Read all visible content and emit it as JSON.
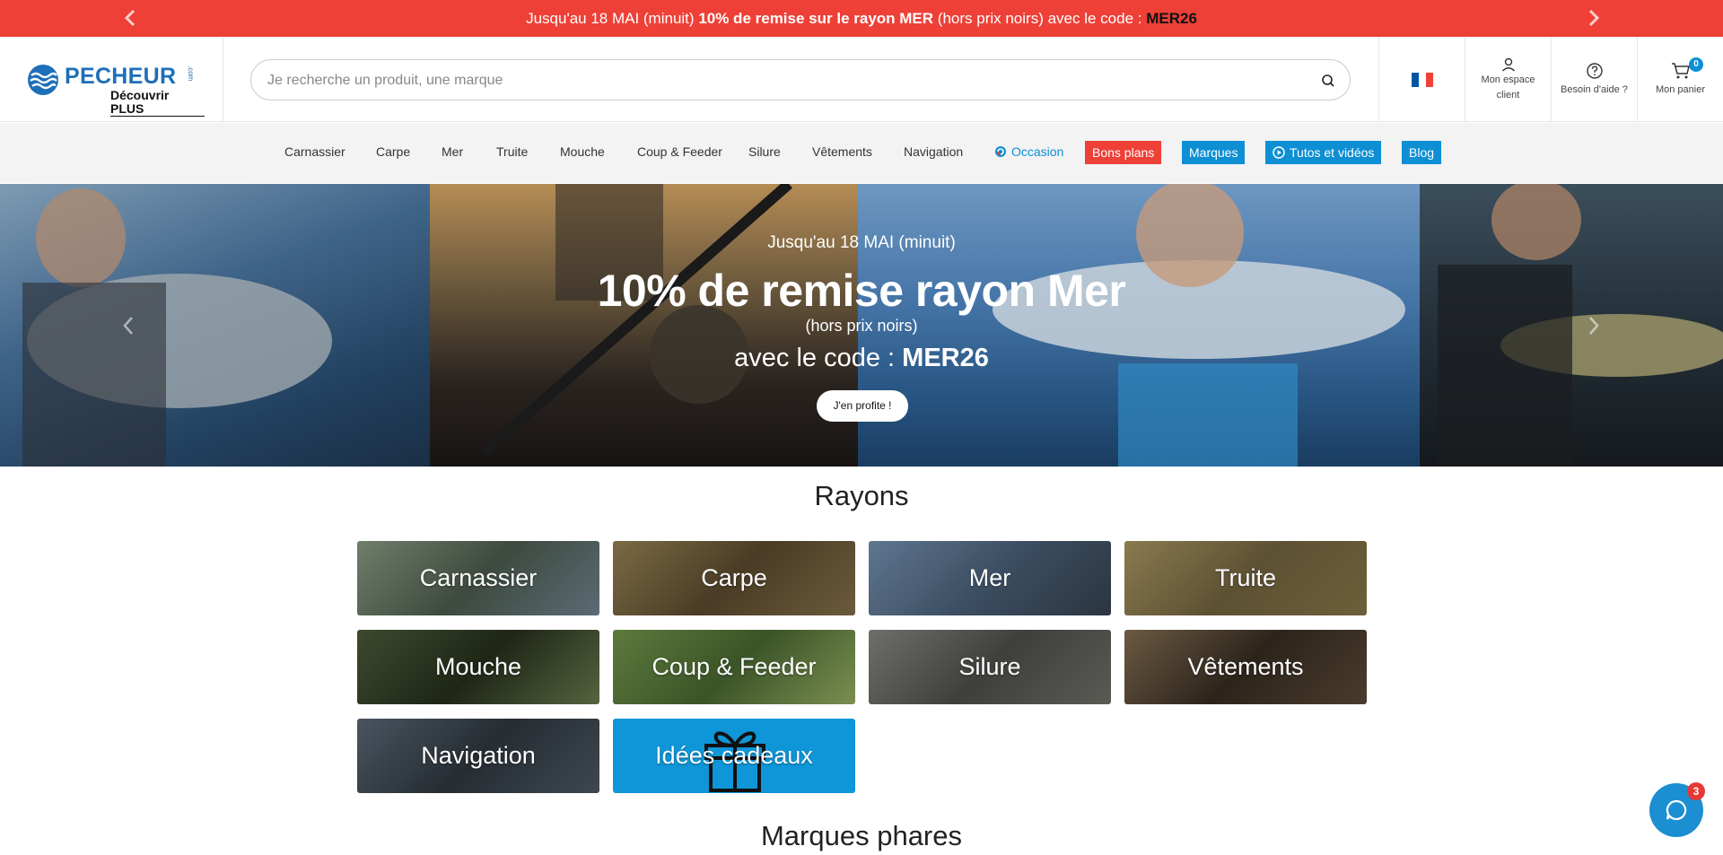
{
  "promo": {
    "text_start": "Jusqu'au 18 MAI (minuit)",
    "text_bold": "10% de remise sur le rayon MER",
    "text_mid": "(hors prix noirs) avec le code :",
    "code": "MER26"
  },
  "header": {
    "logo_word": "PECHEUR",
    "logo_com": ".com",
    "logo_sub": "Découvrir PLUS",
    "search_placeholder": "Je recherche un produit, une marque",
    "account_line1": "Mon espace",
    "account_line2": "client",
    "help_label": "Besoin d'aide ?",
    "cart_label": "Mon panier",
    "cart_count": "0"
  },
  "nav": {
    "items": [
      "Carnassier",
      "Carpe",
      "Mer",
      "Truite",
      "Mouche",
      "Coup & Feeder",
      "Silure",
      "Vêtements",
      "Navigation"
    ],
    "occasion": "Occasion",
    "bons_plans": "Bons plans",
    "marques": "Marques",
    "tutos": "Tutos et vidéos",
    "blog": "Blog"
  },
  "hero": {
    "line1": "Jusqu'au 18 MAI (minuit)",
    "line2": "10% de remise rayon Mer",
    "line3": "(hors prix noirs)",
    "line4_prefix": "avec le code :",
    "line4_code": "MER26",
    "button": "J'en profite !"
  },
  "rayons": {
    "title": "Rayons",
    "tiles": [
      "Carnassier",
      "Carpe",
      "Mer",
      "Truite",
      "Mouche",
      "Coup & Feeder",
      "Silure",
      "Vêtements",
      "Navigation",
      "Idées cadeaux"
    ]
  },
  "marques_title": "Marques phares",
  "chat": {
    "badge": "3"
  },
  "colors": {
    "promo_red": "#ee4037",
    "brand_blue": "#1d6fb8",
    "nav_blue": "#0e8fd3",
    "bons_plans_red": "#ee4037"
  }
}
